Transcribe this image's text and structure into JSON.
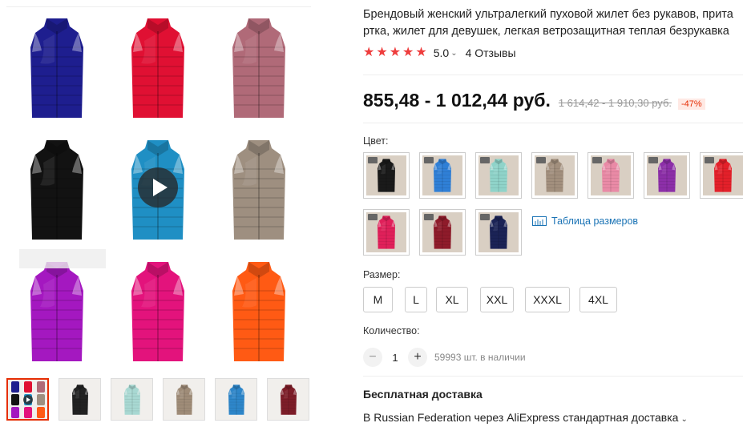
{
  "product": {
    "title_line1": "Брендовый женский ультралегкий пуховой жилет без рукавов, прита",
    "title_line2": "ртка, жилет для девушек, легкая ветрозащитная теплая безрукавка",
    "rating": "5.0",
    "rating_chevron": "⌄",
    "reviews": "4 Отзывы",
    "stars": 5
  },
  "pricing": {
    "price": "855,48 - 1 012,44 руб.",
    "old_price": "1 614,42 - 1 910,30 руб.",
    "discount": "-47%"
  },
  "color": {
    "label": "Цвет:",
    "swatches": [
      {
        "name": "black",
        "color": "#1a1a1a"
      },
      {
        "name": "blue",
        "color": "#2f7fd6"
      },
      {
        "name": "mint",
        "color": "#8fd3c9"
      },
      {
        "name": "khaki",
        "color": "#a28f7d"
      },
      {
        "name": "pink",
        "color": "#e98aa6"
      },
      {
        "name": "purple",
        "color": "#8c2fa8"
      },
      {
        "name": "red",
        "color": "#e3202a"
      },
      {
        "name": "rose",
        "color": "#e0205a"
      },
      {
        "name": "wine",
        "color": "#8e1b2a"
      },
      {
        "name": "navy",
        "color": "#1b2356"
      }
    ],
    "size_chart": "Таблица размеров"
  },
  "size": {
    "label": "Размер:",
    "options": [
      "M",
      "L",
      "XL",
      "XXL",
      "XXXL",
      "4XL"
    ]
  },
  "quantity": {
    "label": "Количество:",
    "minus": "−",
    "plus": "+",
    "value": "1",
    "stock": "59993 шт. в наличии"
  },
  "shipping": {
    "title": "Бесплатная доставка",
    "info": "В Russian Federation через AliExpress стандартная доставка",
    "chevron": "⌄"
  },
  "gallery": {
    "vests": [
      "#1e1e8f",
      "#e01033",
      "#b06a78",
      "#121212",
      "#1f8fc4",
      "#9e8f80",
      "#a418c0",
      "#e3137c",
      "#ff5a14"
    ],
    "thumbs": [
      "collage",
      "#222222",
      "#a8d8d2",
      "#9f8c78",
      "#2e86c9",
      "#7d1d28"
    ]
  }
}
